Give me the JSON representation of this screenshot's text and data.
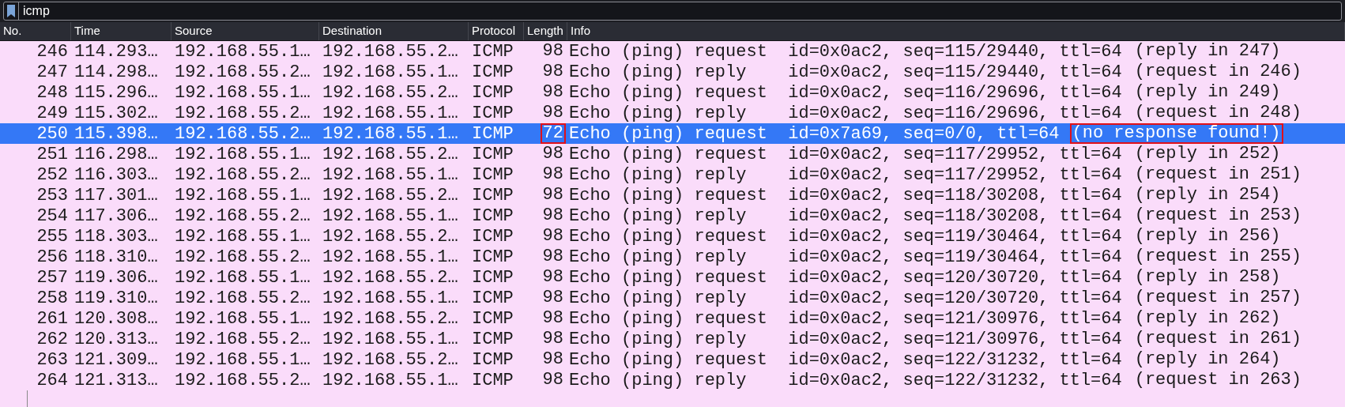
{
  "filter": {
    "value": "icmp"
  },
  "columns": [
    "No.",
    "Time",
    "Source",
    "Destination",
    "Protocol",
    "Length",
    "Info"
  ],
  "rows": [
    {
      "no": "246",
      "time": "114.293…",
      "source": "192.168.55.1…",
      "destination": "192.168.55.2…",
      "protocol": "ICMP",
      "length": "98",
      "length_boxed": false,
      "info": "Echo (ping) request  id=0x0ac2, seq=115/29440, ttl=64",
      "note": "(reply in 247)",
      "note_boxed": false,
      "selected": false
    },
    {
      "no": "247",
      "time": "114.298…",
      "source": "192.168.55.2…",
      "destination": "192.168.55.1…",
      "protocol": "ICMP",
      "length": "98",
      "length_boxed": false,
      "info": "Echo (ping) reply    id=0x0ac2, seq=115/29440, ttl=64",
      "note": "(request in 246)",
      "note_boxed": false,
      "selected": false
    },
    {
      "no": "248",
      "time": "115.296…",
      "source": "192.168.55.1…",
      "destination": "192.168.55.2…",
      "protocol": "ICMP",
      "length": "98",
      "length_boxed": false,
      "info": "Echo (ping) request  id=0x0ac2, seq=116/29696, ttl=64",
      "note": "(reply in 249)",
      "note_boxed": false,
      "selected": false
    },
    {
      "no": "249",
      "time": "115.302…",
      "source": "192.168.55.2…",
      "destination": "192.168.55.1…",
      "protocol": "ICMP",
      "length": "98",
      "length_boxed": false,
      "info": "Echo (ping) reply    id=0x0ac2, seq=116/29696, ttl=64",
      "note": "(request in 248)",
      "note_boxed": false,
      "selected": false
    },
    {
      "no": "250",
      "time": "115.398…",
      "source": "192.168.55.2…",
      "destination": "192.168.55.1…",
      "protocol": "ICMP",
      "length": "72",
      "length_boxed": true,
      "info": "Echo (ping) request  id=0x7a69, seq=0/0, ttl=64",
      "note": "(no response found!)",
      "note_boxed": true,
      "selected": true
    },
    {
      "no": "251",
      "time": "116.298…",
      "source": "192.168.55.1…",
      "destination": "192.168.55.2…",
      "protocol": "ICMP",
      "length": "98",
      "length_boxed": false,
      "info": "Echo (ping) request  id=0x0ac2, seq=117/29952, ttl=64",
      "note": "(reply in 252)",
      "note_boxed": false,
      "selected": false
    },
    {
      "no": "252",
      "time": "116.303…",
      "source": "192.168.55.2…",
      "destination": "192.168.55.1…",
      "protocol": "ICMP",
      "length": "98",
      "length_boxed": false,
      "info": "Echo (ping) reply    id=0x0ac2, seq=117/29952, ttl=64",
      "note": "(request in 251)",
      "note_boxed": false,
      "selected": false
    },
    {
      "no": "253",
      "time": "117.301…",
      "source": "192.168.55.1…",
      "destination": "192.168.55.2…",
      "protocol": "ICMP",
      "length": "98",
      "length_boxed": false,
      "info": "Echo (ping) request  id=0x0ac2, seq=118/30208, ttl=64",
      "note": "(reply in 254)",
      "note_boxed": false,
      "selected": false
    },
    {
      "no": "254",
      "time": "117.306…",
      "source": "192.168.55.2…",
      "destination": "192.168.55.1…",
      "protocol": "ICMP",
      "length": "98",
      "length_boxed": false,
      "info": "Echo (ping) reply    id=0x0ac2, seq=118/30208, ttl=64",
      "note": "(request in 253)",
      "note_boxed": false,
      "selected": false
    },
    {
      "no": "255",
      "time": "118.303…",
      "source": "192.168.55.1…",
      "destination": "192.168.55.2…",
      "protocol": "ICMP",
      "length": "98",
      "length_boxed": false,
      "info": "Echo (ping) request  id=0x0ac2, seq=119/30464, ttl=64",
      "note": "(reply in 256)",
      "note_boxed": false,
      "selected": false
    },
    {
      "no": "256",
      "time": "118.310…",
      "source": "192.168.55.2…",
      "destination": "192.168.55.1…",
      "protocol": "ICMP",
      "length": "98",
      "length_boxed": false,
      "info": "Echo (ping) reply    id=0x0ac2, seq=119/30464, ttl=64",
      "note": "(request in 255)",
      "note_boxed": false,
      "selected": false
    },
    {
      "no": "257",
      "time": "119.306…",
      "source": "192.168.55.1…",
      "destination": "192.168.55.2…",
      "protocol": "ICMP",
      "length": "98",
      "length_boxed": false,
      "info": "Echo (ping) request  id=0x0ac2, seq=120/30720, ttl=64",
      "note": "(reply in 258)",
      "note_boxed": false,
      "selected": false
    },
    {
      "no": "258",
      "time": "119.310…",
      "source": "192.168.55.2…",
      "destination": "192.168.55.1…",
      "protocol": "ICMP",
      "length": "98",
      "length_boxed": false,
      "info": "Echo (ping) reply    id=0x0ac2, seq=120/30720, ttl=64",
      "note": "(request in 257)",
      "note_boxed": false,
      "selected": false
    },
    {
      "no": "261",
      "time": "120.308…",
      "source": "192.168.55.1…",
      "destination": "192.168.55.2…",
      "protocol": "ICMP",
      "length": "98",
      "length_boxed": false,
      "info": "Echo (ping) request  id=0x0ac2, seq=121/30976, ttl=64",
      "note": "(reply in 262)",
      "note_boxed": false,
      "selected": false
    },
    {
      "no": "262",
      "time": "120.313…",
      "source": "192.168.55.2…",
      "destination": "192.168.55.1…",
      "protocol": "ICMP",
      "length": "98",
      "length_boxed": false,
      "info": "Echo (ping) reply    id=0x0ac2, seq=121/30976, ttl=64",
      "note": "(request in 261)",
      "note_boxed": false,
      "selected": false
    },
    {
      "no": "263",
      "time": "121.309…",
      "source": "192.168.55.1…",
      "destination": "192.168.55.2…",
      "protocol": "ICMP",
      "length": "98",
      "length_boxed": false,
      "info": "Echo (ping) request  id=0x0ac2, seq=122/31232, ttl=64",
      "note": "(reply in 264)",
      "note_boxed": false,
      "selected": false
    },
    {
      "no": "264",
      "time": "121.313…",
      "source": "192.168.55.2…",
      "destination": "192.168.55.1…",
      "protocol": "ICMP",
      "length": "98",
      "length_boxed": false,
      "info": "Echo (ping) reply    id=0x0ac2, seq=122/31232, ttl=64",
      "note": "(request in 263)",
      "note_boxed": false,
      "selected": false
    }
  ]
}
